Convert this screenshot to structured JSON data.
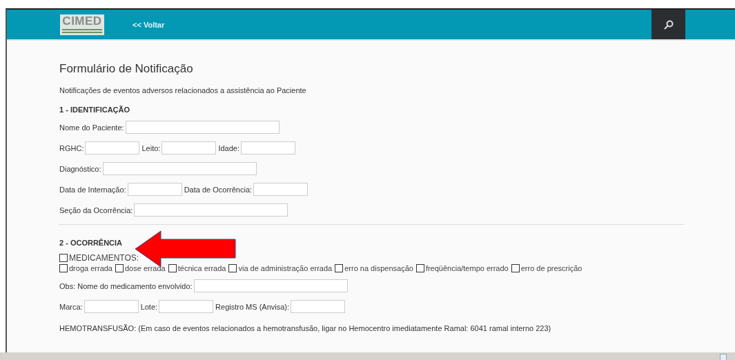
{
  "header": {
    "logo": {
      "title": "CIMED"
    },
    "back_link": "<< Voltar"
  },
  "form": {
    "title": "Formulário de Notificação",
    "subtitle": "Notificações de eventos adversos relacionados a assistência ao Paciente",
    "section_1": {
      "title": "1 - IDENTIFICAÇÃO",
      "lines": [
        {
          "fields": [
            {
              "label": "Nome do Paciente:"
            }
          ]
        },
        {
          "fields": [
            {
              "label": "RGHC:"
            },
            {
              "label": "Leito:"
            },
            {
              "label": "Idade:"
            }
          ]
        },
        {
          "fields": [
            {
              "label": "Diagnóstico:"
            }
          ]
        },
        {
          "fields": [
            {
              "label": "Data de Internação:"
            },
            {
              "label": "Data de Ocorrência:"
            }
          ]
        },
        {
          "fields": [
            {
              "label": "Seção da Ocorrência:"
            }
          ]
        }
      ]
    },
    "section_2": {
      "title": "2 - OCORRÊNCIA",
      "group": {
        "label": "MEDICAMENTOS:",
        "checked": false
      },
      "options": [
        {
          "label": "droga errada",
          "checked": false
        },
        {
          "label": "dose errada",
          "checked": false
        },
        {
          "label": "técnica errada",
          "checked": false
        },
        {
          "label": "via de administração errada",
          "checked": false
        },
        {
          "label": "erro na dispensação",
          "checked": false
        },
        {
          "label": "freqüência/tempo errado",
          "checked": false
        },
        {
          "label": "erro de prescrição",
          "checked": false
        }
      ],
      "lines": [
        {
          "fields": [
            {
              "label": "Obs: Nome do medicamento envolvido:"
            }
          ]
        },
        {
          "fields": [
            {
              "label": "Marca:"
            },
            {
              "label": "Lote:"
            },
            {
              "label": "Registro MS (Anvisa):"
            }
          ]
        }
      ],
      "note": "HEMOTRANSFUSÃO: (Em caso de eventos relacionados a hemotransfusão, ligar no Hemocentro imediatamente Ramal: 6041 ramal interno 223)"
    }
  }
}
